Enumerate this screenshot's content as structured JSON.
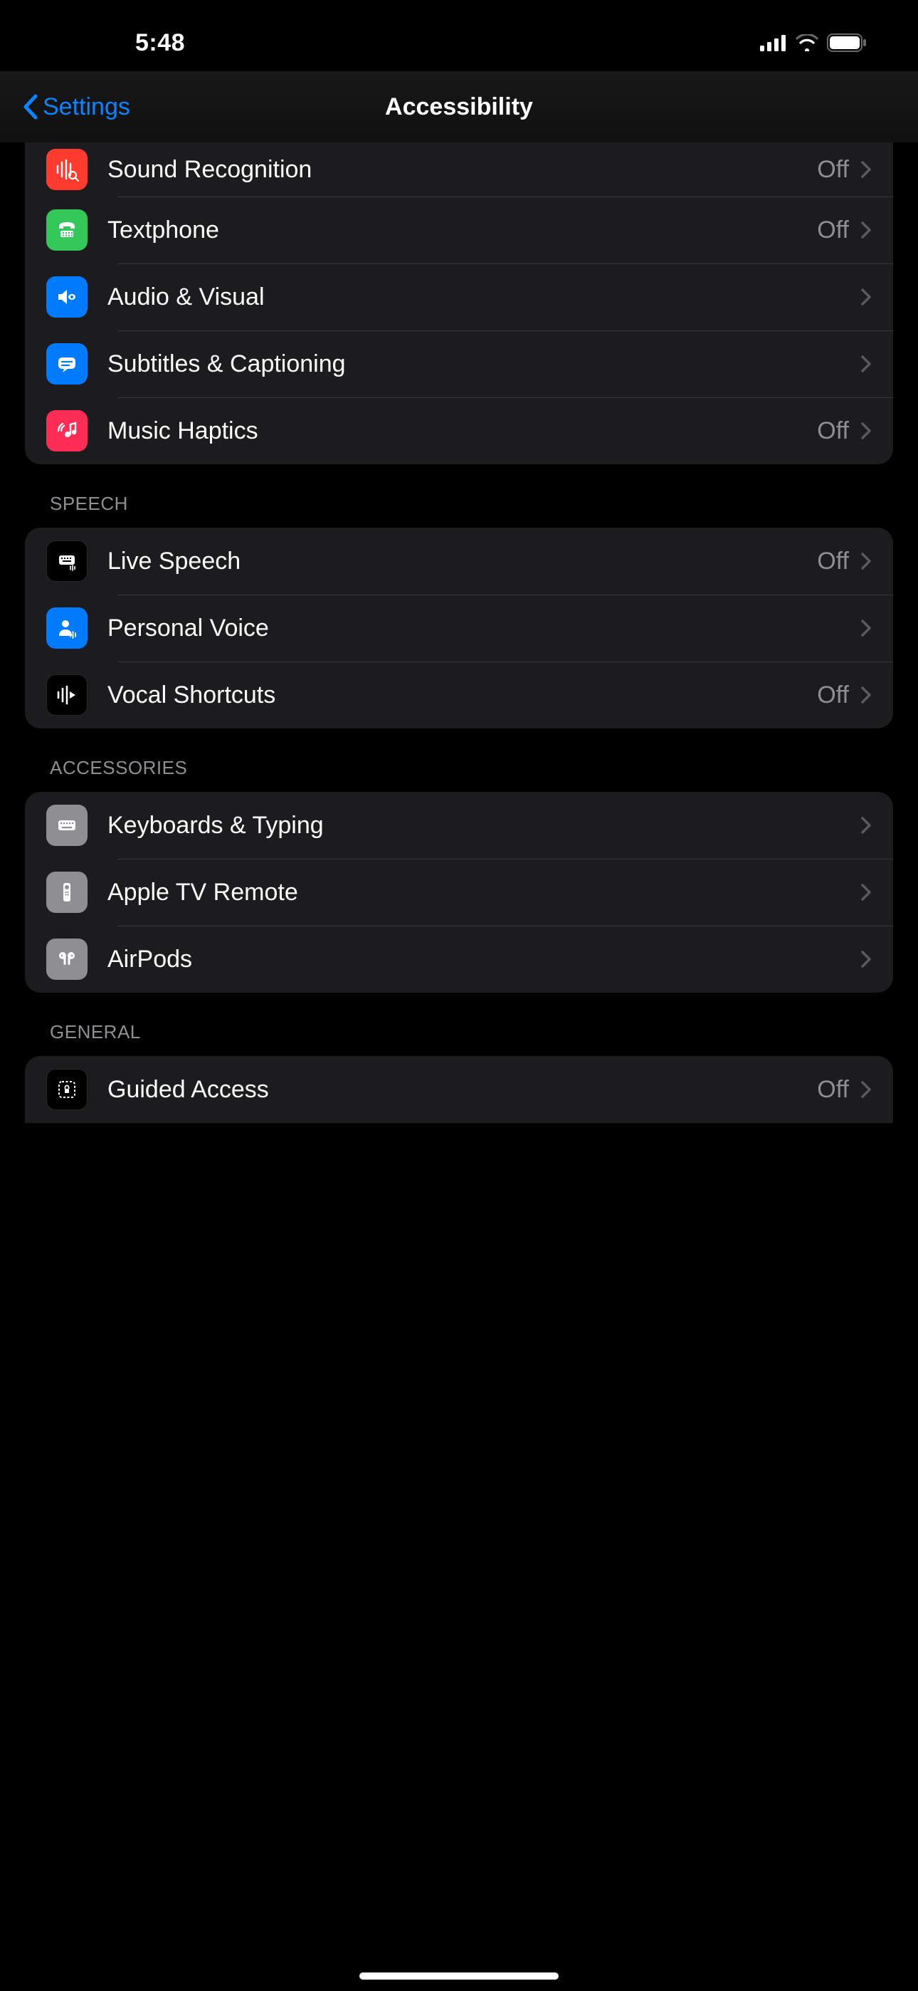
{
  "status": {
    "time": "5:48"
  },
  "nav": {
    "back": "Settings",
    "title": "Accessibility"
  },
  "valueOff": "Off",
  "groups": [
    {
      "header": null,
      "rows": [
        {
          "id": "sound-recognition",
          "label": "Sound Recognition",
          "value": "Off",
          "color": "bg-red"
        },
        {
          "id": "textphone",
          "label": "Textphone",
          "value": "Off",
          "color": "bg-green"
        },
        {
          "id": "audio-visual",
          "label": "Audio & Visual",
          "value": null,
          "color": "bg-blue"
        },
        {
          "id": "subtitles-captioning",
          "label": "Subtitles & Captioning",
          "value": null,
          "color": "bg-blue"
        },
        {
          "id": "music-haptics",
          "label": "Music Haptics",
          "value": "Off",
          "color": "bg-pink"
        }
      ]
    },
    {
      "header": "SPEECH",
      "rows": [
        {
          "id": "live-speech",
          "label": "Live Speech",
          "value": "Off",
          "color": "bg-black"
        },
        {
          "id": "personal-voice",
          "label": "Personal Voice",
          "value": null,
          "color": "bg-blue"
        },
        {
          "id": "vocal-shortcuts",
          "label": "Vocal Shortcuts",
          "value": "Off",
          "color": "bg-black"
        }
      ]
    },
    {
      "header": "ACCESSORIES",
      "rows": [
        {
          "id": "keyboards-typing",
          "label": "Keyboards & Typing",
          "value": null,
          "color": "bg-gray"
        },
        {
          "id": "apple-tv-remote",
          "label": "Apple TV Remote",
          "value": null,
          "color": "bg-gray"
        },
        {
          "id": "airpods",
          "label": "AirPods",
          "value": null,
          "color": "bg-gray"
        }
      ]
    },
    {
      "header": "GENERAL",
      "rows": [
        {
          "id": "guided-access",
          "label": "Guided Access",
          "value": "Off",
          "color": "bg-black"
        }
      ]
    }
  ]
}
